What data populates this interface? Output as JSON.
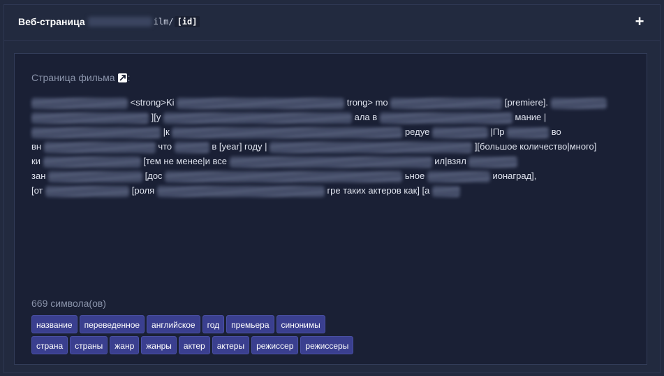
{
  "header": {
    "title": "Веб-страница",
    "route_suffix": "ilm/",
    "route_param": "[id]",
    "expand_label": "+"
  },
  "content": {
    "page_label": "Страница фильма",
    "colon": ":",
    "icon": "external-link-icon",
    "template_lines": [
      [
        "<strong>Ki",
        "trong> mo",
        "[premiere]."
      ],
      [
        " ][у",
        "ала в",
        "мание |"
      ],
      [
        "|к",
        "редуе",
        "|Пр",
        "во"
      ],
      [
        "вн",
        "что",
        "в [year] году",
        "|",
        "][большое количество|много]"
      ],
      [
        "ки",
        "[тем не менее|и все",
        "ил|взял"
      ],
      [
        "зан",
        "[дос",
        "ьное",
        "ионаград],"
      ],
      [
        "[от",
        "[роля",
        "гре таких актеров как] [а"
      ]
    ],
    "char_count": "669 символа(ов)"
  },
  "tags": {
    "row1": [
      "название",
      "переведенное",
      "английское",
      "год",
      "премьера",
      "синонимы"
    ],
    "row2": [
      "страна",
      "страны",
      "жанр",
      "жанры",
      "актер",
      "актеры",
      "режиссер",
      "режиссеры"
    ]
  },
  "colors": {
    "background": "#222a3f",
    "content_bg": "#1a2035",
    "tag_bg": "#3a3f8f"
  }
}
